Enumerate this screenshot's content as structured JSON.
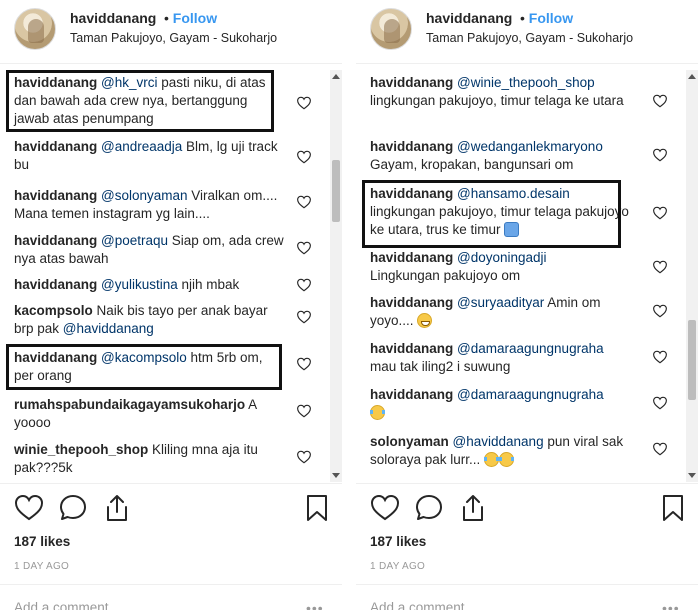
{
  "left": {
    "header": {
      "username": "haviddanang",
      "dot": "•",
      "follow": "Follow",
      "location": "Taman Pakujoyo, Gayam - Sukoharjo"
    },
    "comments": [
      {
        "user": "haviddanang",
        "mention": "@hk_vrci",
        "text": " pasti niku, di atas dan bawah ada crew nya, bertanggung jawab atas penumpang"
      },
      {
        "user": "haviddanang",
        "mention": "@andreaadja",
        "text": " Blm, lg uji track bu"
      },
      {
        "user": "haviddanang",
        "mention": "@solonyaman",
        "text": " Viralkan om.... Mana temen instagram yg lain...."
      },
      {
        "user": "haviddanang",
        "mention": "@poetraqu",
        "text": " Siap om, ada crew nya atas bawah"
      },
      {
        "user": "haviddanang",
        "mention": "@yulikustina",
        "text": " njih mbak"
      },
      {
        "user": "kacompsolo",
        "text": " Naik bis tayo per anak bayar brp pak ",
        "mention_end": "@haviddanang"
      },
      {
        "user": "haviddanang",
        "mention": "@kacompsolo",
        "text": " htm 5rb om, per orang"
      },
      {
        "user": "rumahspabundaikagayamsukoharjo",
        "text": " A yoooo"
      },
      {
        "user": "winie_thepooh_shop",
        "text": " Kliling mna aja itu pak???5k"
      }
    ],
    "likes": "187 likes",
    "time_ago": "1 DAY AGO",
    "add_comment": "Add a comment...",
    "more": "•••"
  },
  "right": {
    "header": {
      "username": "haviddanang",
      "dot": "•",
      "follow": "Follow",
      "location": "Taman Pakujoyo, Gayam - Sukoharjo"
    },
    "comments": [
      {
        "user": "haviddanang",
        "mention": "@winie_thepooh_shop",
        "text": "lingkungan pakujoyo, timur telaga ke utara"
      },
      {
        "user": "haviddanang",
        "mention": "@wedanganlekmaryono",
        "text": "Gayam, kropakan, bangunsari om"
      },
      {
        "user": "haviddanang",
        "mention": "@hansamo.desain",
        "text": "lingkungan pakujoyo, timur telaga pakujoyo ke utara, trus ke timur"
      },
      {
        "user": "haviddanang",
        "mention": "@doyoningadji",
        "text": "Lingkungan pakujoyo om"
      },
      {
        "user": "haviddanang",
        "mention": "@suryaadityar",
        "text": " Amin om yoyo...."
      },
      {
        "user": "haviddanang",
        "mention": "@damaraagungnugraha",
        "text": "mau tak iling2 i suwung"
      },
      {
        "user": "haviddanang",
        "mention": "@damaraagungnugraha",
        "text": ""
      },
      {
        "user": "solonyaman",
        "mention": "@haviddanang",
        "text": " pun viral sak soloraya pak lurr..."
      }
    ],
    "likes": "187 likes",
    "time_ago": "1 DAY AGO",
    "add_comment": "Add a comment...",
    "more": "•••"
  },
  "icons": {
    "heart": "heart-outline-icon",
    "like": "heart-icon",
    "comment": "comment-bubble-icon",
    "share": "share-upload-icon",
    "save": "bookmark-icon",
    "emoji_grin": "grinning-face-emoji",
    "emoji_tears": "tears-of-joy-emoji",
    "emoji_person": "person-emoji"
  },
  "colors": {
    "follow": "#3897f0",
    "mention": "#003569",
    "muted": "#999999",
    "text": "#262626"
  }
}
